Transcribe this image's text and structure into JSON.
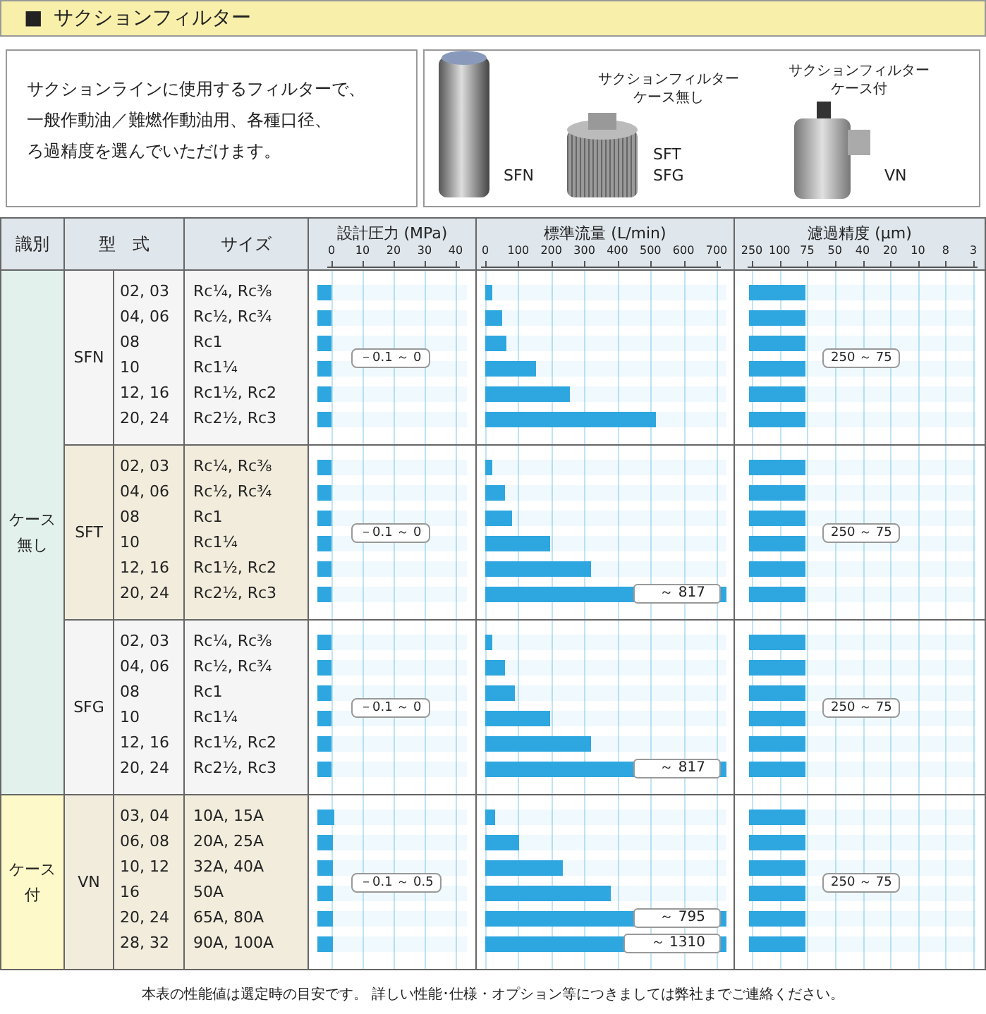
{
  "title": {
    "mark": "■",
    "text": "サクションフィルター"
  },
  "intro_lines": [
    "サクションラインに使用するフィルターで、",
    "一般作動油／難燃作動油用、各種口径、",
    "ろ過精度を選んでいただけます。"
  ],
  "products": [
    {
      "labels": [
        "SFN"
      ]
    },
    {
      "caption": [
        "サクションフィルター",
        "ケース無し"
      ],
      "labels": [
        "SFT",
        "SFG"
      ]
    },
    {
      "caption": [
        "サクションフィルター",
        "ケース付"
      ],
      "labels": [
        "VN"
      ]
    }
  ],
  "columns": {
    "category": "識別",
    "model": "型　式",
    "size": "サイズ",
    "pressure": {
      "title": "設計圧力 (MPa)",
      "ticks": [
        "0",
        "10",
        "20",
        "30",
        "40"
      ]
    },
    "flow": {
      "title": "標準流量 (L/min)",
      "ticks": [
        "0",
        "100",
        "200",
        "300",
        "400",
        "500",
        "600",
        "700"
      ]
    },
    "filtration": {
      "title": "濾過精度 (μm)",
      "ticks": [
        "250",
        "100",
        "75",
        "50",
        "40",
        "20",
        "10",
        "8",
        "3"
      ]
    }
  },
  "categories": [
    {
      "label": [
        "ケース",
        "無し"
      ],
      "groups": [
        {
          "model": "SFN",
          "pressure_range": "－0.1 ～ 0",
          "filtration_range": "250 ～ 75",
          "rows": [
            {
              "no": "02, 03",
              "size": "Rc¼, Rc⅜",
              "pressure": {
                "level": 0.09
              },
              "flow": {
                "level": 0.03
              },
              "filtration": {
                "level": 0.25
              }
            },
            {
              "no": "04, 06",
              "size": "Rc½, Rc¾",
              "pressure": {
                "level": 0.09
              },
              "flow": {
                "level": 0.07
              },
              "filtration": {
                "level": 0.25
              }
            },
            {
              "no": "08",
              "size": "Rc1",
              "pressure": {
                "level": 0.09
              },
              "flow": {
                "level": 0.09
              },
              "filtration": {
                "level": 0.25
              }
            },
            {
              "no": "10",
              "size": "Rc1¼",
              "pressure": {
                "level": 0.09
              },
              "flow": {
                "level": 0.21
              },
              "filtration": {
                "level": 0.25
              }
            },
            {
              "no": "12, 16",
              "size": "Rc1½, Rc2",
              "pressure": {
                "level": 0.09
              },
              "flow": {
                "level": 0.35
              },
              "filtration": {
                "level": 0.25
              }
            },
            {
              "no": "20, 24",
              "size": "Rc2½, Rc3",
              "pressure": {
                "level": 0.09
              },
              "flow": {
                "level": 0.71
              },
              "filtration": {
                "level": 0.25
              }
            }
          ]
        },
        {
          "model": "SFT",
          "pressure_range": "－0.1 ～ 0",
          "filtration_range": "250 ～ 75",
          "rows": [
            {
              "no": "02, 03",
              "size": "Rc¼, Rc⅜",
              "pressure": {
                "level": 0.09
              },
              "flow": {
                "level": 0.03
              },
              "filtration": {
                "level": 0.25
              }
            },
            {
              "no": "04, 06",
              "size": "Rc½, Rc¾",
              "pressure": {
                "level": 0.09
              },
              "flow": {
                "level": 0.08
              },
              "filtration": {
                "level": 0.25
              }
            },
            {
              "no": "08",
              "size": "Rc1",
              "pressure": {
                "level": 0.09
              },
              "flow": {
                "level": 0.11
              },
              "filtration": {
                "level": 0.25
              }
            },
            {
              "no": "10",
              "size": "Rc1¼",
              "pressure": {
                "level": 0.09
              },
              "flow": {
                "level": 0.27
              },
              "filtration": {
                "level": 0.25
              }
            },
            {
              "no": "12, 16",
              "size": "Rc1½, Rc2",
              "pressure": {
                "level": 0.09
              },
              "flow": {
                "level": 0.44
              },
              "filtration": {
                "level": 0.25
              }
            },
            {
              "no": "20, 24",
              "size": "Rc2½, Rc3",
              "pressure": {
                "level": 0.09
              },
              "flow": {
                "level": 1.0,
                "note": "～ 817"
              },
              "filtration": {
                "level": 0.25
              }
            }
          ]
        },
        {
          "model": "SFG",
          "pressure_range": "－0.1 ～ 0",
          "filtration_range": "250 ～ 75",
          "rows": [
            {
              "no": "02, 03",
              "size": "Rc¼, Rc⅜",
              "pressure": {
                "level": 0.09
              },
              "flow": {
                "level": 0.03
              },
              "filtration": {
                "level": 0.25
              }
            },
            {
              "no": "04, 06",
              "size": "Rc½, Rc¾",
              "pressure": {
                "level": 0.09
              },
              "flow": {
                "level": 0.08
              },
              "filtration": {
                "level": 0.25
              }
            },
            {
              "no": "08",
              "size": "Rc1",
              "pressure": {
                "level": 0.09
              },
              "flow": {
                "level": 0.12
              },
              "filtration": {
                "level": 0.25
              }
            },
            {
              "no": "10",
              "size": "Rc1¼",
              "pressure": {
                "level": 0.09
              },
              "flow": {
                "level": 0.27
              },
              "filtration": {
                "level": 0.25
              }
            },
            {
              "no": "12, 16",
              "size": "Rc1½, Rc2",
              "pressure": {
                "level": 0.09
              },
              "flow": {
                "level": 0.44
              },
              "filtration": {
                "level": 0.25
              }
            },
            {
              "no": "20, 24",
              "size": "Rc2½, Rc3",
              "pressure": {
                "level": 0.09
              },
              "flow": {
                "level": 1.0,
                "note": "～ 817"
              },
              "filtration": {
                "level": 0.25
              }
            }
          ]
        }
      ]
    },
    {
      "label": [
        "ケース",
        "付"
      ],
      "groups": [
        {
          "model": "VN",
          "pressure_range": "－0.1 ～ 0.5",
          "filtration_range": "250 ～ 75",
          "rows": [
            {
              "no": "03, 04",
              "size": "10A, 15A",
              "pressure": {
                "level": 0.11
              },
              "flow": {
                "level": 0.04
              },
              "filtration": {
                "level": 0.25
              }
            },
            {
              "no": "06, 08",
              "size": "20A, 25A",
              "pressure": {
                "level": 0.1
              },
              "flow": {
                "level": 0.14
              },
              "filtration": {
                "level": 0.25
              }
            },
            {
              "no": "10, 12",
              "size": "32A, 40A",
              "pressure": {
                "level": 0.1
              },
              "flow": {
                "level": 0.32
              },
              "filtration": {
                "level": 0.25
              }
            },
            {
              "no": "16",
              "size": "50A",
              "pressure": {
                "level": 0.1
              },
              "flow": {
                "level": 0.52
              },
              "filtration": {
                "level": 0.25
              }
            },
            {
              "no": "20, 24",
              "size": "65A, 80A",
              "pressure": {
                "level": 0.1
              },
              "flow": {
                "level": 1.0,
                "note": "～ 795"
              },
              "filtration": {
                "level": 0.25
              }
            },
            {
              "no": "28, 32",
              "size": "90A, 100A",
              "pressure": {
                "level": 0.1
              },
              "flow": {
                "level": 1.0,
                "note": "～ 1310"
              },
              "filtration": {
                "level": 0.25
              }
            }
          ]
        }
      ]
    }
  ],
  "footnote": "本表の性能値は選定時の目安です。 詳しい性能･仕様・オプション等につきましては弊社までご連絡ください。"
}
